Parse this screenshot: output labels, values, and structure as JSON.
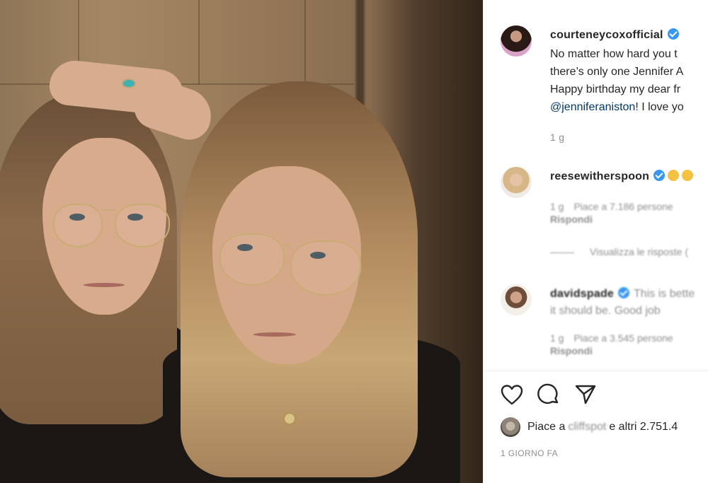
{
  "post": {
    "username": "courteneycoxofficial",
    "caption_lines": [
      "No matter how hard you t",
      "there’s only one Jennifer A",
      "Happy birthday my dear fr"
    ],
    "caption_mention": "@jenniferaniston",
    "caption_tail": "! I love yo",
    "time": "1 g"
  },
  "comments": [
    {
      "username": "reesewitherspoon",
      "text": "",
      "time": "1 g",
      "likes": "Piace a 7.186 persone",
      "reply": "Rispondi"
    },
    {
      "username": "davidspade",
      "text": "This is bette",
      "text_cont": "it should be. Good job",
      "time": "1 g",
      "likes": "Piace a 3.545 persone",
      "reply": "Rispondi"
    }
  ],
  "view_replies": "Visualizza le risposte (",
  "likes_bar": {
    "prefix": "Piace a",
    "name": "cliffspot",
    "suffix": "e altri 2.751.4"
  },
  "post_date": "1 GIORNO FA",
  "icons": {
    "like": "heart-icon",
    "comment": "comment-icon",
    "share": "share-icon",
    "verified": "verified-badge-icon"
  },
  "colors": {
    "verified": "#3897f0",
    "mention": "#00376b",
    "secondary_text": "#8e8e8e"
  }
}
